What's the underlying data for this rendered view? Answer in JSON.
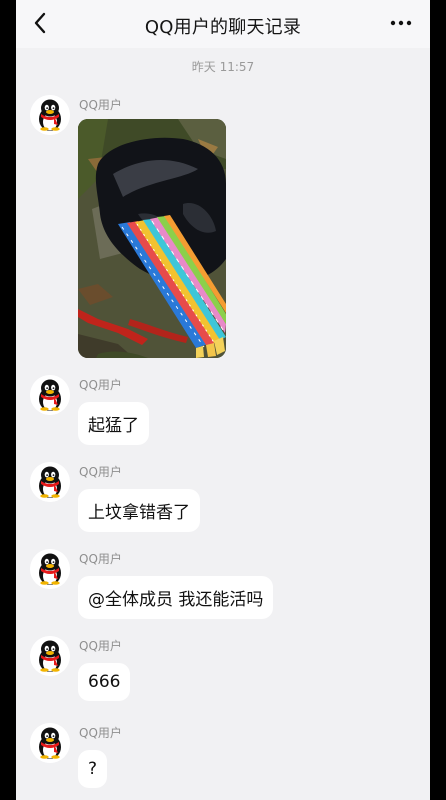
{
  "header": {
    "title": "QQ用户的聊天记录",
    "back_icon": "back-chevron-icon",
    "more_icon": "more-dots-icon"
  },
  "timestamp": "昨天 11:57",
  "messages": [
    {
      "sender": "QQ用户",
      "type": "image"
    },
    {
      "sender": "QQ用户",
      "type": "text",
      "text": "起猛了"
    },
    {
      "sender": "QQ用户",
      "type": "text",
      "text": "上坟拿错香了"
    },
    {
      "sender": "QQ用户",
      "type": "text",
      "text": "@全体成员 我还能活吗"
    },
    {
      "sender": "QQ用户",
      "type": "text",
      "text": "666"
    },
    {
      "sender": "QQ用户",
      "type": "text",
      "text": "?"
    }
  ],
  "colors": {
    "background": "#f1f1f3",
    "header": "#f7f7f9",
    "bubble": "#ffffff",
    "sender_name": "#8f8f8f"
  }
}
